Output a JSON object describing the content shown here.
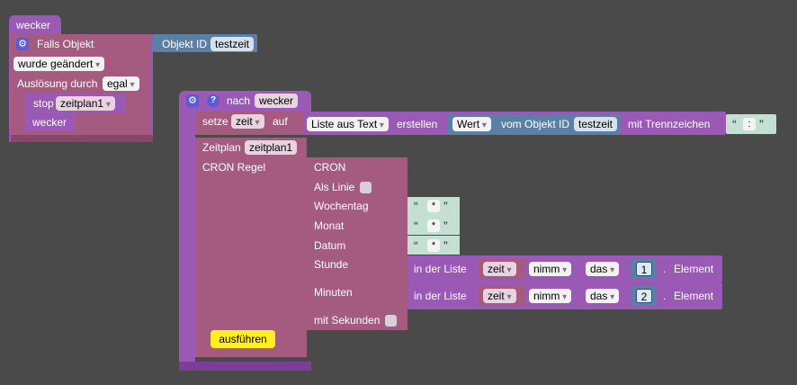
{
  "block_wecker": {
    "title": "wecker",
    "event_label": "Falls Objekt",
    "object_id_label": "Objekt ID",
    "object_id_value": "testzeit",
    "changed_select": "wurde geändert",
    "trigger_label": "Auslösung durch",
    "trigger_select": "egal",
    "stop_label": "stop",
    "stop_select": "zeitplan1",
    "call_label": "wecker"
  },
  "block_nach": {
    "nach_label": "nach",
    "nach_value": "wecker",
    "setze_label": "setze",
    "var_select": "zeit",
    "auf_label": "auf",
    "list_select": "Liste aus Text",
    "erstellen_label": "erstellen",
    "wert_select": "Wert",
    "vom_label": "vom Objekt ID",
    "vom_value": "testzeit",
    "trenn_label": "mit Trennzeichen",
    "trenn_value": ":",
    "zeitplan_label": "Zeitplan",
    "zeitplan_value": "zeitplan1",
    "cron_regel_label": "CRON Regel",
    "run_button": "ausführen"
  },
  "cron": {
    "title": "CRON",
    "als_linie": "Als Linie",
    "wochentag": "Wochentag",
    "monat": "Monat",
    "datum": "Datum",
    "stunde": "Stunde",
    "minuten": "Minuten",
    "sekunden": "mit Sekunden",
    "star": "*"
  },
  "list_get": {
    "in_der_liste": "in der Liste",
    "var": "zeit",
    "mode": "nimm",
    "das": "das",
    "element": "Element",
    "dot": ".",
    "hour_index": "1",
    "minute_index": "2"
  },
  "glyphs": {
    "open_quote": "“",
    "close_quote": "”",
    "gear": "⚙",
    "help": "?"
  },
  "colors": {
    "background": "#4a4a4a",
    "purple": "#9b59b6",
    "magenta": "#a55b80",
    "blue": "#5b80a5",
    "text_block": "#c3e0d2",
    "button": "#ffee22"
  }
}
